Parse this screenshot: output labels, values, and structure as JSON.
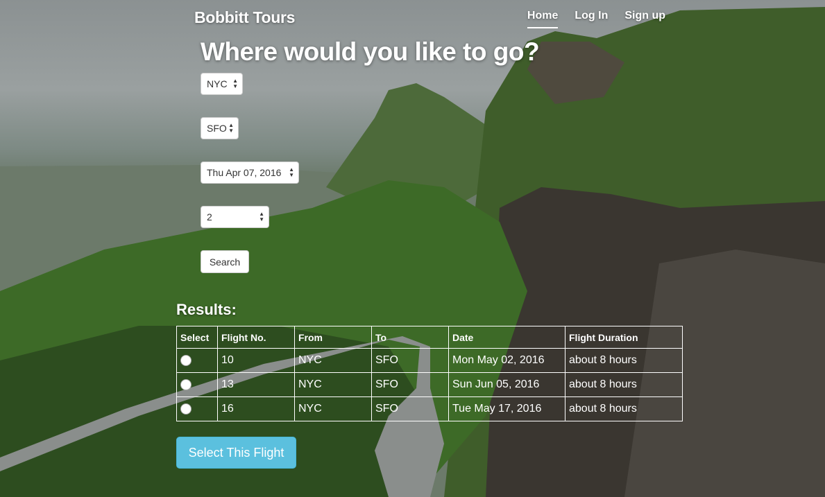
{
  "brand": "Bobbitt Tours",
  "nav": {
    "home": "Home",
    "login": "Log In",
    "signup": "Sign up"
  },
  "headline": "Where would you like to go?",
  "form": {
    "from": "NYC",
    "to": "SFO",
    "date": "Thu Apr 07, 2016",
    "passengers": "2",
    "search_label": "Search"
  },
  "results": {
    "title": "Results:",
    "headers": [
      "Select",
      "Flight No.",
      "From",
      "To",
      "Date",
      "Flight Duration"
    ],
    "rows": [
      {
        "flight": "10",
        "from": "NYC",
        "to": "SFO",
        "date": "Mon May 02, 2016",
        "duration": "about 8 hours"
      },
      {
        "flight": "13",
        "from": "NYC",
        "to": "SFO",
        "date": "Sun Jun 05, 2016",
        "duration": "about 8 hours"
      },
      {
        "flight": "16",
        "from": "NYC",
        "to": "SFO",
        "date": "Tue May 17, 2016",
        "duration": "about 8 hours"
      }
    ]
  },
  "select_flight_label": "Select This Flight",
  "colors": {
    "accent": "#5bc0de"
  }
}
